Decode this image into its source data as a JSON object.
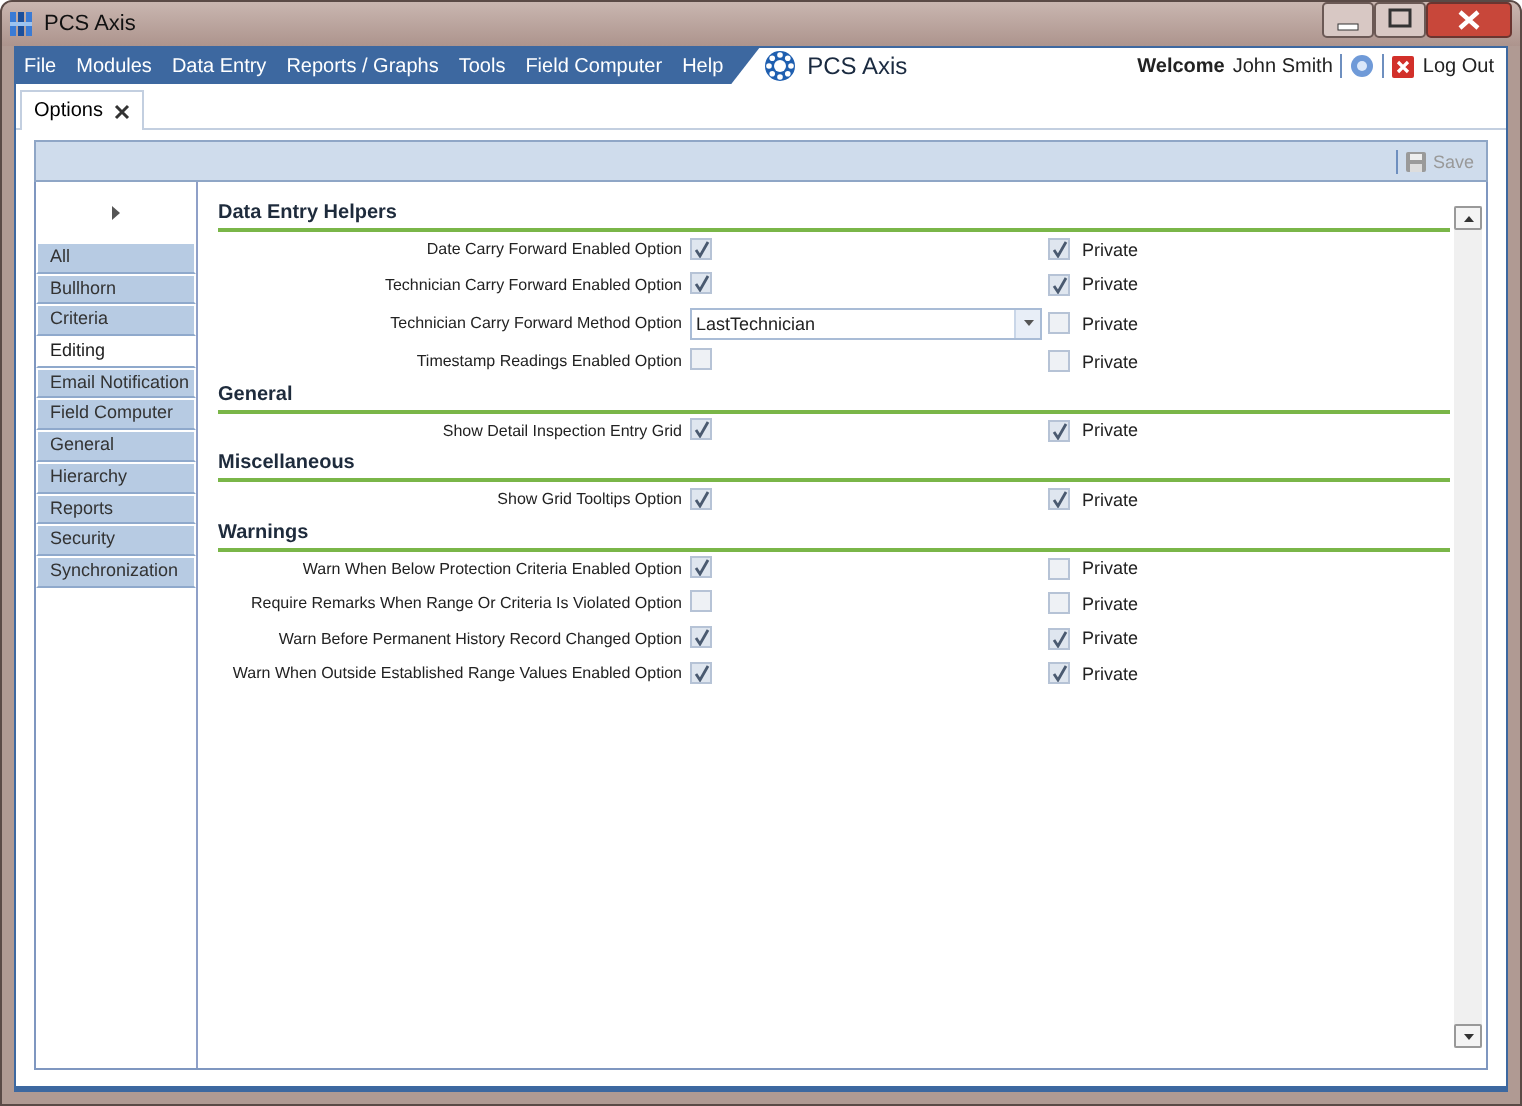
{
  "window": {
    "title": "PCS Axis"
  },
  "menu": {
    "items": [
      "File",
      "Modules",
      "Data Entry",
      "Reports / Graphs",
      "Tools",
      "Field Computer",
      "Help"
    ]
  },
  "brand": {
    "name": "PCS Axis"
  },
  "user": {
    "welcome": "Welcome",
    "name": "John Smith",
    "logout": "Log Out"
  },
  "tabs": [
    {
      "label": "Options",
      "selected": true
    }
  ],
  "toolbar": {
    "save": {
      "label": "Save",
      "disabled": true
    }
  },
  "sidebar": {
    "items": [
      {
        "label": "All",
        "selected": false
      },
      {
        "label": "Bullhorn",
        "selected": false
      },
      {
        "label": "Criteria",
        "selected": false
      },
      {
        "label": "Editing",
        "selected": true
      },
      {
        "label": "Email Notification",
        "selected": false
      },
      {
        "label": "Field Computer",
        "selected": false
      },
      {
        "label": "General",
        "selected": false
      },
      {
        "label": "Hierarchy",
        "selected": false
      },
      {
        "label": "Reports",
        "selected": false
      },
      {
        "label": "Security",
        "selected": false
      },
      {
        "label": "Synchronization",
        "selected": false
      }
    ]
  },
  "sections": [
    {
      "title": "Data Entry Helpers",
      "options": [
        {
          "kind": "checkbox",
          "label": "Date Carry Forward Enabled Option",
          "checked": true,
          "private_label": "Private",
          "private_checked": true
        },
        {
          "kind": "checkbox",
          "label": "Technician Carry Forward Enabled Option",
          "checked": true,
          "private_label": "Private",
          "private_checked": true
        },
        {
          "kind": "dropdown",
          "label": "Technician Carry Forward Method Option",
          "value": "LastTechnician",
          "private_label": "Private",
          "private_checked": false
        },
        {
          "kind": "checkbox",
          "label": "Timestamp Readings Enabled Option",
          "checked": false,
          "private_label": "Private",
          "private_checked": false
        }
      ]
    },
    {
      "title": "General",
      "options": [
        {
          "kind": "checkbox",
          "label": "Show Detail Inspection Entry Grid",
          "checked": true,
          "private_label": "Private",
          "private_checked": true
        }
      ]
    },
    {
      "title": "Miscellaneous",
      "options": [
        {
          "kind": "checkbox",
          "label": "Show Grid Tooltips Option",
          "checked": true,
          "private_label": "Private",
          "private_checked": true
        }
      ]
    },
    {
      "title": "Warnings",
      "options": [
        {
          "kind": "checkbox",
          "label": "Warn When Below Protection Criteria Enabled Option",
          "checked": true,
          "private_label": "Private",
          "private_checked": false
        },
        {
          "kind": "checkbox",
          "label": "Require Remarks When Range Or Criteria Is Violated Option",
          "checked": false,
          "private_label": "Private",
          "private_checked": false
        },
        {
          "kind": "checkbox",
          "label": "Warn Before Permanent History Record Changed Option",
          "checked": true,
          "private_label": "Private",
          "private_checked": true
        },
        {
          "kind": "checkbox",
          "label": "Warn When Outside Established Range Values Enabled Option",
          "checked": true,
          "private_label": "Private",
          "private_checked": true
        }
      ]
    }
  ]
}
